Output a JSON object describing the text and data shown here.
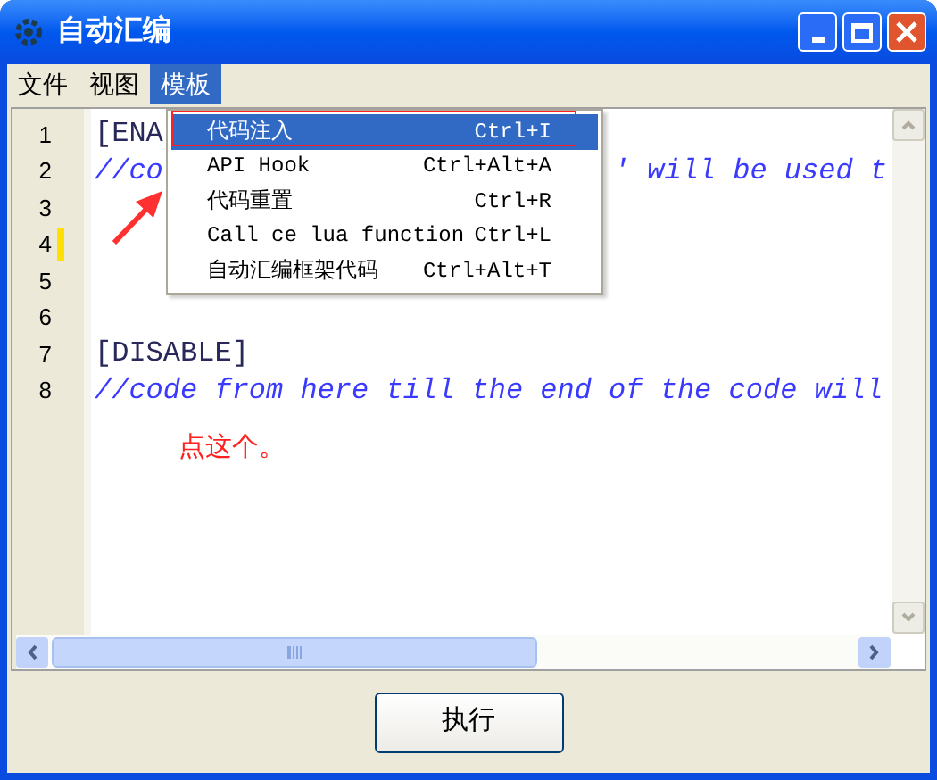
{
  "window": {
    "title": "自动汇编"
  },
  "menu": [
    {
      "label": "文件",
      "selected": false
    },
    {
      "label": "视图",
      "selected": false
    },
    {
      "label": "模板",
      "selected": true
    }
  ],
  "editor": {
    "lines": [
      {
        "number": "1",
        "marked": false,
        "segments": [
          {
            "kind": "section",
            "text": "[ENA"
          }
        ]
      },
      {
        "number": "2",
        "marked": false,
        "segments": [
          {
            "kind": "comment",
            "text": "//co"
          },
          {
            "kind": "comment",
            "text": "' will be used t"
          }
        ]
      },
      {
        "number": "3",
        "marked": false
      },
      {
        "number": "4",
        "marked": true
      },
      {
        "number": "5",
        "marked": false
      },
      {
        "number": "6",
        "marked": false
      },
      {
        "number": "7",
        "marked": false,
        "segments": [
          {
            "kind": "section",
            "text": "[DISABLE]"
          }
        ]
      },
      {
        "number": "8",
        "marked": false,
        "segments": [
          {
            "kind": "comment",
            "text": "//code from here till the end of the code will"
          }
        ]
      }
    ]
  },
  "dropdown": {
    "items": [
      {
        "label": "代码注入",
        "shortcut": "Ctrl+I",
        "selected": true
      },
      {
        "label": "API Hook",
        "shortcut": "Ctrl+Alt+A",
        "selected": false
      },
      {
        "label": "代码重置",
        "shortcut": "Ctrl+R",
        "selected": false
      },
      {
        "label": "Call ce lua function",
        "shortcut": "Ctrl+L",
        "selected": false
      },
      {
        "label": "自动汇编框架代码",
        "shortcut": "Ctrl+Alt+T",
        "selected": false
      }
    ]
  },
  "annotation": {
    "text": "点这个。"
  },
  "buttons": [
    {
      "label": "执行"
    }
  ]
}
